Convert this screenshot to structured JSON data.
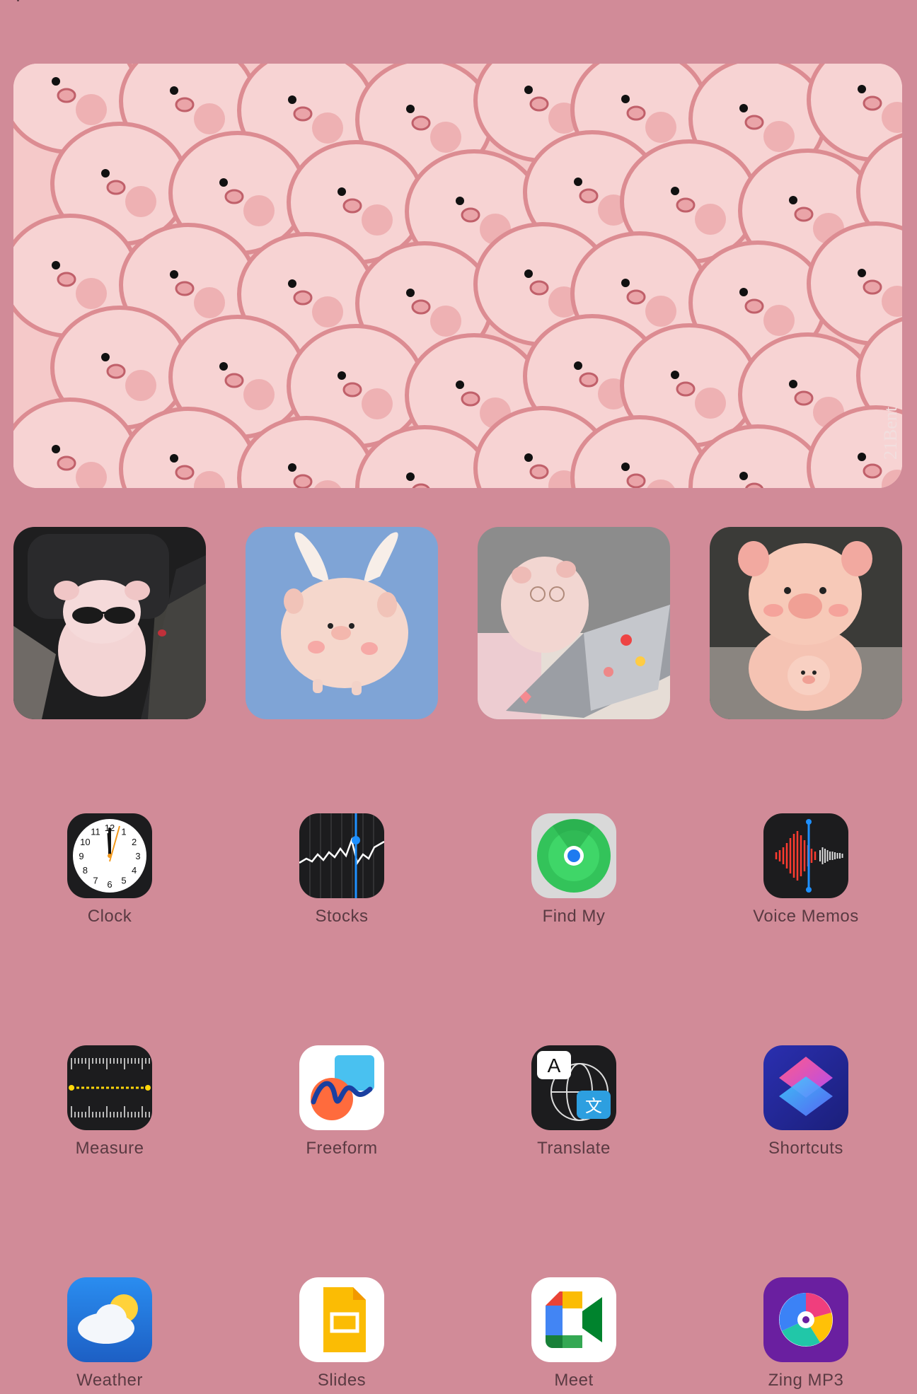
{
  "wallpaper": {
    "color": "#d18b98"
  },
  "widgets": {
    "banner": {
      "name": "pig-pattern-photo-widget",
      "signature": "21Bent"
    },
    "photos": [
      {
        "name": "pig-sunglasses-photo"
      },
      {
        "name": "flying-pig-plush-photo"
      },
      {
        "name": "pig-laptop-photo"
      },
      {
        "name": "pig-plush-with-baby-photo"
      }
    ]
  },
  "apps": [
    {
      "label": "Clock",
      "icon": "clock-icon"
    },
    {
      "label": "Stocks",
      "icon": "stocks-icon"
    },
    {
      "label": "Find My",
      "icon": "find-my-icon"
    },
    {
      "label": "Voice Memos",
      "icon": "voice-memos-icon"
    },
    {
      "label": "Measure",
      "icon": "measure-icon"
    },
    {
      "label": "Freeform",
      "icon": "freeform-icon"
    },
    {
      "label": "Translate",
      "icon": "translate-icon"
    },
    {
      "label": "Shortcuts",
      "icon": "shortcuts-icon"
    },
    {
      "label": "Weather",
      "icon": "weather-icon"
    },
    {
      "label": "Slides",
      "icon": "slides-icon"
    },
    {
      "label": "Meet",
      "icon": "meet-icon"
    },
    {
      "label": "Zing MP3",
      "icon": "zing-mp3-icon"
    }
  ],
  "clock_face": {
    "numbers": [
      "12",
      "1",
      "2",
      "3",
      "4",
      "5",
      "6",
      "7",
      "8",
      "9",
      "10",
      "11"
    ]
  },
  "translate_glyphs": {
    "latin": "A",
    "cjk": "文"
  }
}
